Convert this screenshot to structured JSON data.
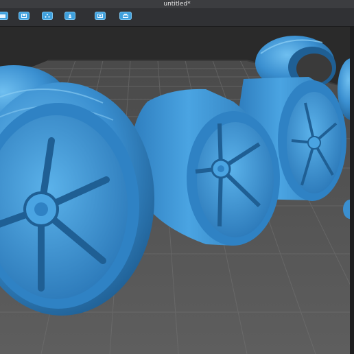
{
  "window": {
    "title": "untitled*"
  },
  "toolbar": {
    "buttons": [
      {
        "icon": "open-file-icon"
      },
      {
        "icon": "save-file-icon"
      },
      {
        "icon": "support-tree-icon"
      },
      {
        "icon": "slice-icon"
      },
      {
        "icon": "preview-layer-icon"
      },
      {
        "icon": "print-icon"
      }
    ]
  },
  "colors": {
    "model": "#3a8fd0",
    "model_light": "#6fbff0",
    "model_dark": "#1f5f94",
    "bed": "#5b5b5b",
    "grid": "#6e6e6e",
    "background": "#2a2a2a",
    "accent": "#3fa0dd"
  }
}
